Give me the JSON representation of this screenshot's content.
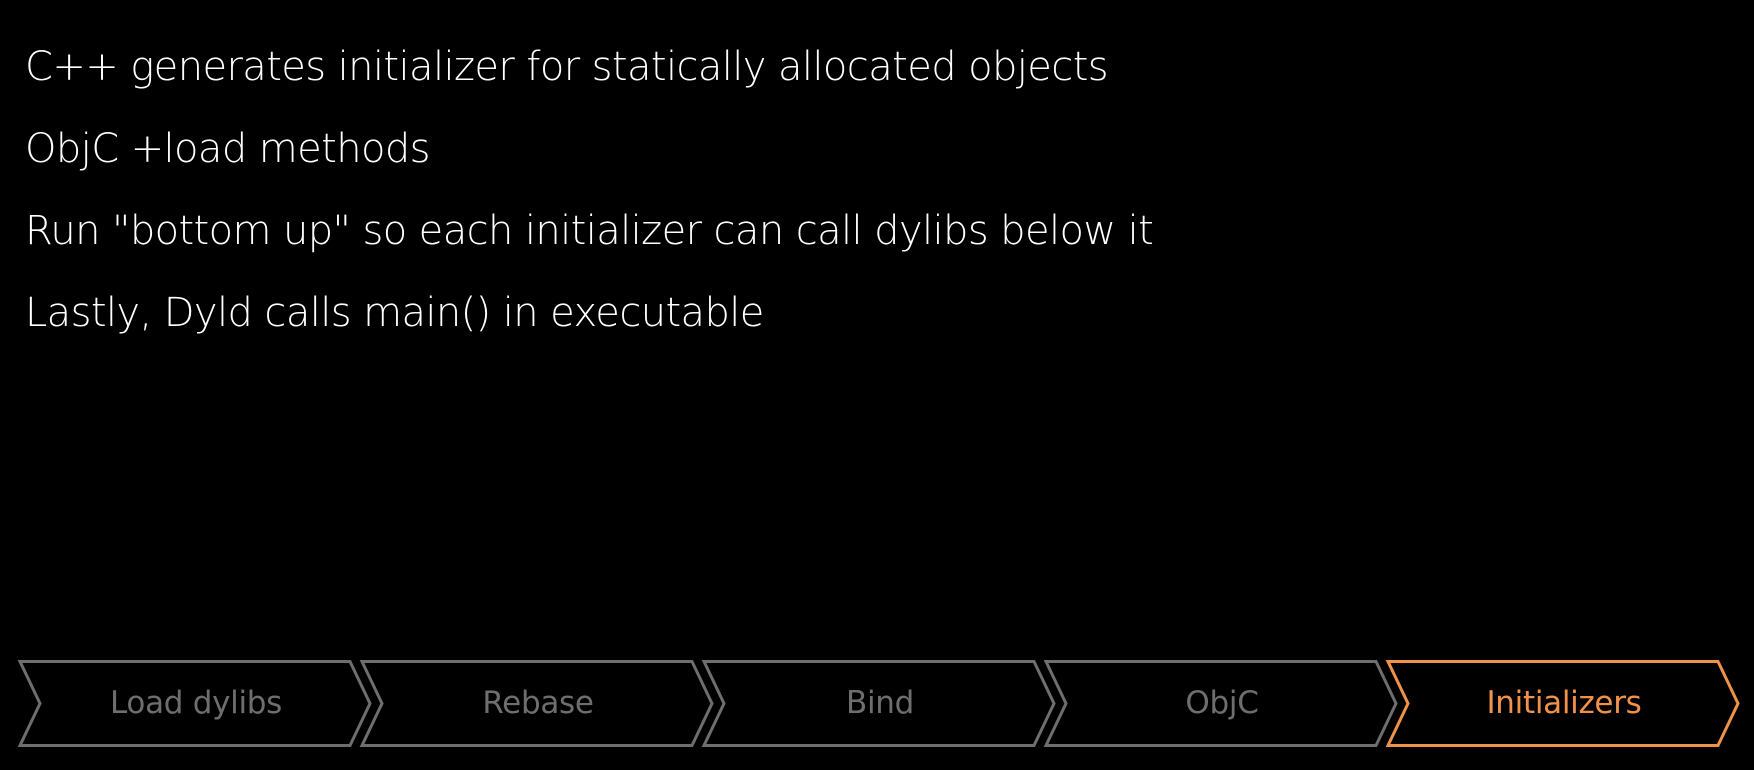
{
  "bullets": [
    "C++ generates initializer for statically allocated objects",
    "ObjC +load methods",
    "Run \"bottom up\" so each initializer can call dylibs below it",
    "Lastly, Dyld calls main() in executable"
  ],
  "pipeline": {
    "steps": [
      {
        "label": "Load dylibs",
        "active": false
      },
      {
        "label": "Rebase",
        "active": false
      },
      {
        "label": "Bind",
        "active": false
      },
      {
        "label": "ObjC",
        "active": false
      },
      {
        "label": "Initializers",
        "active": true
      }
    ],
    "inactive_color": "#6e6e6e",
    "active_color": "#f0924a"
  }
}
